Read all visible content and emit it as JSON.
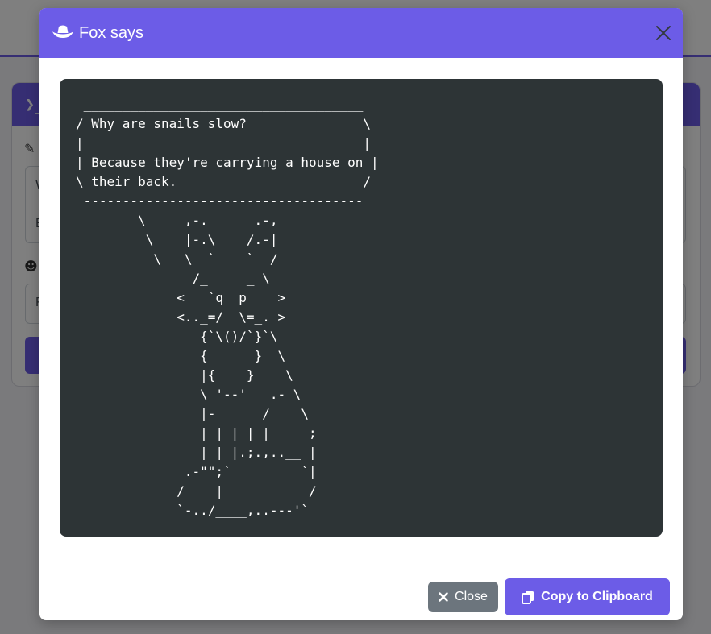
{
  "colors": {
    "accent": "#6c5ce7",
    "code_background": "#2d3436",
    "secondary_button": "#6c757d"
  },
  "background_page": {
    "header_icon": "terminal-icon",
    "row_icons": [
      "pencil-icon",
      "smile-icon"
    ],
    "textarea_visible_text": [
      "W",
      "B"
    ],
    "select_visible_text": "F"
  },
  "modal": {
    "title": "Fox says",
    "title_icon": "cowboy-hat-icon",
    "close_icon": "close-icon",
    "ascii_art": " ____________________________________\n/ Why are snails slow?               \\\n|                                    |\n| Because they're carrying a house on |\n\\ their back.                        /\n ------------------------------------\n        \\     ,-.      .-,\n         \\    |-.\\ __ /.-|\n          \\   \\  `    `  /\n               /_     _ \\\n             <  _`q  p _  >\n             <.._=/  \\=_. >\n                {`\\()/`}`\\\n                {      }  \\\n                |{    }    \\\n                \\ '--'   .- \\\n                |-      /    \\\n                | | | | |     ;\n                | | |.;.,..__ |\n              .-\"\";`         `|\n             /    |           /\n             `-../____,..---'`",
    "footer": {
      "close_label": "Close",
      "close_icon": "x-icon",
      "copy_label": "Copy to Clipboard",
      "copy_icon": "clipboard-icon"
    }
  }
}
